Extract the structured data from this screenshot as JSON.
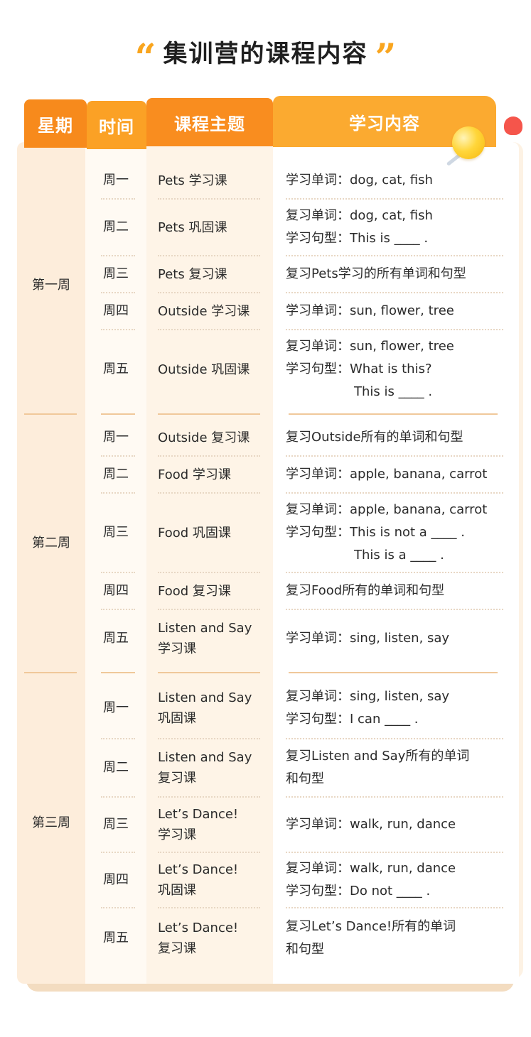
{
  "title": "集训营的课程内容",
  "title_quote_open": "“",
  "title_quote_close": "”",
  "header": {
    "week": "星期",
    "time": "时间",
    "topic": "课程主题",
    "content": "学习内容"
  },
  "weeks": [
    {
      "label": "第一周",
      "rows": [
        {
          "day": "周一",
          "topic": [
            "Pets 学习课"
          ],
          "content": [
            "学习单词：dog, cat, fish"
          ]
        },
        {
          "day": "周二",
          "topic": [
            "Pets 巩固课"
          ],
          "content": [
            "复习单词：dog, cat, fish",
            "学习句型：This is ____ ."
          ]
        },
        {
          "day": "周三",
          "topic": [
            "Pets 复习课"
          ],
          "content": [
            "复习Pets学习的所有单词和句型"
          ]
        },
        {
          "day": "周四",
          "topic": [
            "Outside 学习课"
          ],
          "content": [
            "学习单词：sun, flower, tree"
          ]
        },
        {
          "day": "周五",
          "topic": [
            "Outside 巩固课"
          ],
          "content": [
            "复习单词：sun, flower, tree",
            "学习句型：What is this?",
            "This is ____ ."
          ]
        }
      ]
    },
    {
      "label": "第二周",
      "rows": [
        {
          "day": "周一",
          "topic": [
            "Outside 复习课"
          ],
          "content": [
            "复习Outside所有的单词和句型"
          ]
        },
        {
          "day": "周二",
          "topic": [
            "Food 学习课"
          ],
          "content": [
            "学习单词：apple, banana, carrot"
          ]
        },
        {
          "day": "周三",
          "topic": [
            "Food 巩固课"
          ],
          "content": [
            "复习单词：apple, banana, carrot",
            "学习句型：This is not a ____ .",
            "This is a ____ ."
          ]
        },
        {
          "day": "周四",
          "topic": [
            "Food 复习课"
          ],
          "content": [
            "复习Food所有的单词和句型"
          ]
        },
        {
          "day": "周五",
          "topic": [
            "Listen and Say",
            "学习课"
          ],
          "content": [
            "学习单词：sing, listen, say"
          ]
        }
      ]
    },
    {
      "label": "第三周",
      "rows": [
        {
          "day": "周一",
          "topic": [
            "Listen and Say",
            "巩固课"
          ],
          "content": [
            "复习单词：sing, listen, say",
            "学习句型：I can ____ ."
          ]
        },
        {
          "day": "周二",
          "topic": [
            "Listen and Say",
            "复习课"
          ],
          "content": [
            "复习Listen and Say所有的单词",
            "和句型"
          ]
        },
        {
          "day": "周三",
          "topic": [
            "Let’s Dance!",
            "学习课"
          ],
          "content": [
            "学习单词：walk, run, dance"
          ]
        },
        {
          "day": "周四",
          "topic": [
            "Let’s Dance!",
            "巩固课"
          ],
          "content": [
            "复习单词：walk, run, dance",
            "学习句型：Do not ____ ."
          ]
        },
        {
          "day": "周五",
          "topic": [
            "Let’s Dance!",
            "复习课"
          ],
          "content": [
            "复习Let’s Dance!所有的单词",
            "和句型"
          ]
        }
      ]
    }
  ],
  "colors": {
    "accent_orange": "#f78a1c",
    "accent_light": "#fbaa30",
    "quote": "#f9a51e",
    "week_col_bg": "#fdeddb"
  },
  "icons": [
    "quote-open-icon",
    "quote-close-icon",
    "lollipop-icon",
    "red-drop-icon"
  ]
}
